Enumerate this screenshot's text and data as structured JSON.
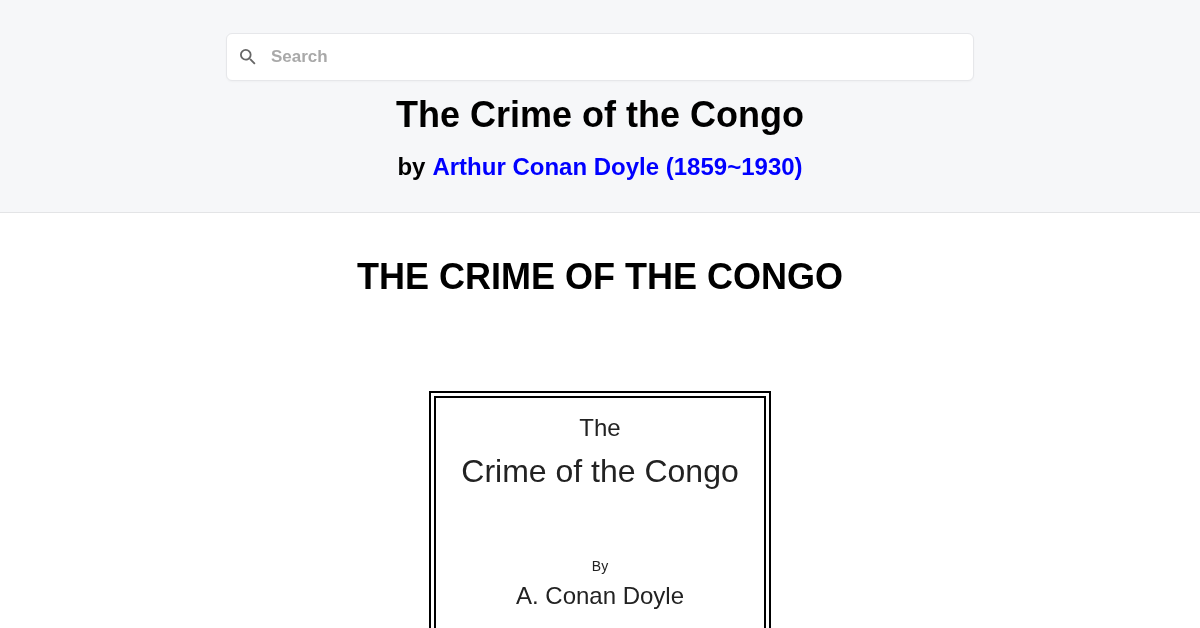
{
  "search": {
    "placeholder": "Search"
  },
  "header": {
    "title": "The Crime of the Congo",
    "byline": {
      "prefix": "by",
      "author": "Arthur Conan Doyle (1859~1930)"
    }
  },
  "content": {
    "heading": "THE CRIME OF THE CONGO",
    "title_page": {
      "article": "The",
      "title": "Crime of the Congo",
      "by": "By",
      "author": "A. Conan Doyle"
    }
  }
}
